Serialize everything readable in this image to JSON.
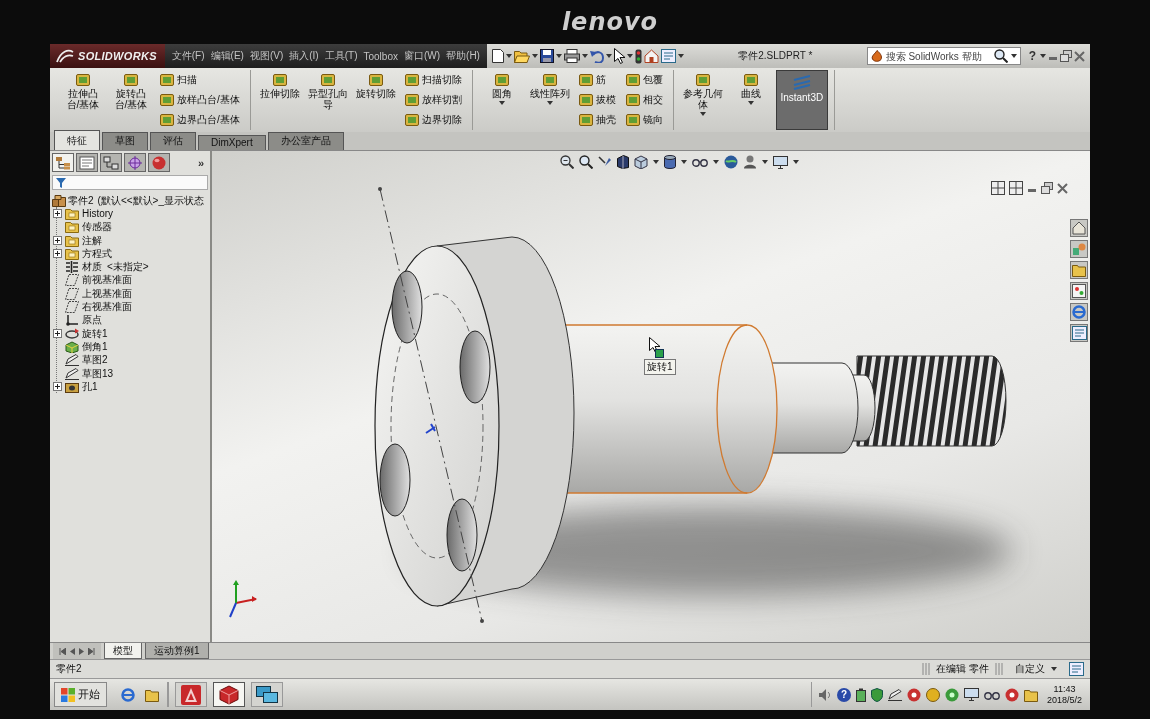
{
  "monitor": {
    "brand": "lenovo"
  },
  "app": {
    "logo": "SOLIDWORKS",
    "menus": [
      "文件(F)",
      "编辑(E)",
      "视图(V)",
      "插入(I)",
      "工具(T)",
      "Toolbox",
      "窗口(W)",
      "帮助(H)"
    ],
    "document_title": "零件2.SLDPRT *",
    "search": {
      "placeholder": "搜索 SolidWorks 帮助"
    },
    "help": "?"
  },
  "command_groups": [
    {
      "items": [
        {
          "kind": "large",
          "label": "拉伸凸台/基体",
          "on": false,
          "dropdown": false
        },
        {
          "kind": "large",
          "label": "旋转凸台/基体",
          "on": false,
          "dropdown": false
        },
        {
          "kind": "small",
          "buttons": [
            "扫描",
            "放样凸台/基体",
            "边界凸台/基体"
          ]
        }
      ]
    },
    {
      "items": [
        {
          "kind": "large",
          "label": "拉伸切除",
          "on": false,
          "dropdown": false
        },
        {
          "kind": "large",
          "label": "异型孔向导",
          "on": false,
          "dropdown": false
        },
        {
          "kind": "large",
          "label": "旋转切除",
          "on": false,
          "dropdown": false
        },
        {
          "kind": "small",
          "buttons": [
            "扫描切除",
            "放样切割",
            "边界切除"
          ]
        }
      ]
    },
    {
      "items": [
        {
          "kind": "large",
          "label": "圆角",
          "on": false,
          "dropdown": true
        },
        {
          "kind": "large",
          "label": "线性阵列",
          "on": false,
          "dropdown": true
        },
        {
          "kind": "small",
          "buttons": [
            "筋",
            "拔模",
            "抽壳"
          ]
        },
        {
          "kind": "small",
          "buttons": [
            "包覆",
            "相交",
            "镜向"
          ]
        }
      ]
    },
    {
      "items": [
        {
          "kind": "large",
          "label": "参考几何体",
          "on": false,
          "dropdown": true
        },
        {
          "kind": "large",
          "label": "曲线",
          "on": false,
          "dropdown": true
        },
        {
          "kind": "large",
          "label": "Instant3D",
          "on": true,
          "dropdown": false
        }
      ]
    }
  ],
  "tabs": [
    {
      "label": "特征",
      "selected": true
    },
    {
      "label": "草图",
      "selected": false
    },
    {
      "label": "评估",
      "selected": false
    },
    {
      "label": "DimXpert",
      "selected": false
    },
    {
      "label": "办公室产品",
      "selected": false
    }
  ],
  "feature_manager": {
    "panel_tabs": [
      {
        "kind": "tree",
        "selected": true
      },
      {
        "kind": "sheet",
        "selected": false
      },
      {
        "kind": "boxes",
        "selected": false
      },
      {
        "kind": "crosshair",
        "selected": false
      },
      {
        "kind": "sphere",
        "selected": false
      }
    ],
    "more": "»",
    "tree": {
      "kind": "part",
      "label": "零件2",
      "note": "(默认<<默认>_显示状态",
      "children": [
        {
          "kind": "folder",
          "label": "History",
          "expandable": true
        },
        {
          "kind": "folder",
          "label": "传感器",
          "expandable": false
        },
        {
          "kind": "folder",
          "label": "注解",
          "expandable": true
        },
        {
          "kind": "folder",
          "label": "方程式",
          "expandable": true
        },
        {
          "kind": "material",
          "label": "材质",
          "note": "<未指定>",
          "expandable": false
        },
        {
          "kind": "plane",
          "label": "前视基准面",
          "expandable": false
        },
        {
          "kind": "plane",
          "label": "上视基准面",
          "expandable": false
        },
        {
          "kind": "plane",
          "label": "右视基准面",
          "expandable": false
        },
        {
          "kind": "origin",
          "label": "原点",
          "expandable": false
        },
        {
          "kind": "revolve",
          "label": "旋转1",
          "expandable": true
        },
        {
          "kind": "chamfer",
          "label": "倒角1",
          "expandable": false
        },
        {
          "kind": "sketch",
          "label": "草图2",
          "expandable": false
        },
        {
          "kind": "sketch",
          "label": "草图13",
          "expandable": false
        },
        {
          "kind": "hole",
          "label": "孔1",
          "expandable": true
        }
      ]
    }
  },
  "viewport": {
    "tooltip": "旋转1"
  },
  "bottom_tabs": [
    {
      "label": "模型",
      "selected": true
    },
    {
      "label": "运动算例1",
      "selected": false
    }
  ],
  "status_bar": {
    "document": "零件2",
    "state": "在编辑 零件",
    "units": "自定义"
  },
  "taskbar": {
    "start": "开始",
    "apps": [
      {
        "kind": "triangle",
        "selected": false
      },
      {
        "kind": "cube",
        "selected": true
      },
      {
        "kind": "screens",
        "selected": false
      }
    ],
    "help": "?",
    "time": "11:43",
    "date": "2018/5/2"
  }
}
